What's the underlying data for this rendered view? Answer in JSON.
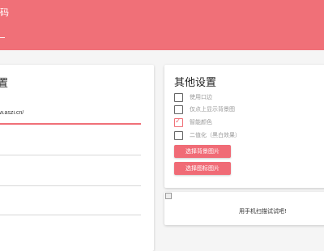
{
  "header": {
    "title": "码",
    "accent_color": "#f07078"
  },
  "left_card": {
    "title": "置",
    "url_value": "/w.aszi.cn/"
  },
  "right_card": {
    "title": "其他设置",
    "options": [
      {
        "label": "使用口边",
        "checked": false
      },
      {
        "label": "仅点上显示背景图",
        "checked": false
      },
      {
        "label": "智能颜色",
        "checked": true
      },
      {
        "label": "二值化（黑白效果）",
        "checked": false
      }
    ],
    "buttons": {
      "choose_background": "选择背景图片",
      "choose_icon": "选择图标图片"
    }
  },
  "qr_card": {
    "scan_text": "用手机扫描试试吧!",
    "image_icon": "broken-image-icon"
  }
}
